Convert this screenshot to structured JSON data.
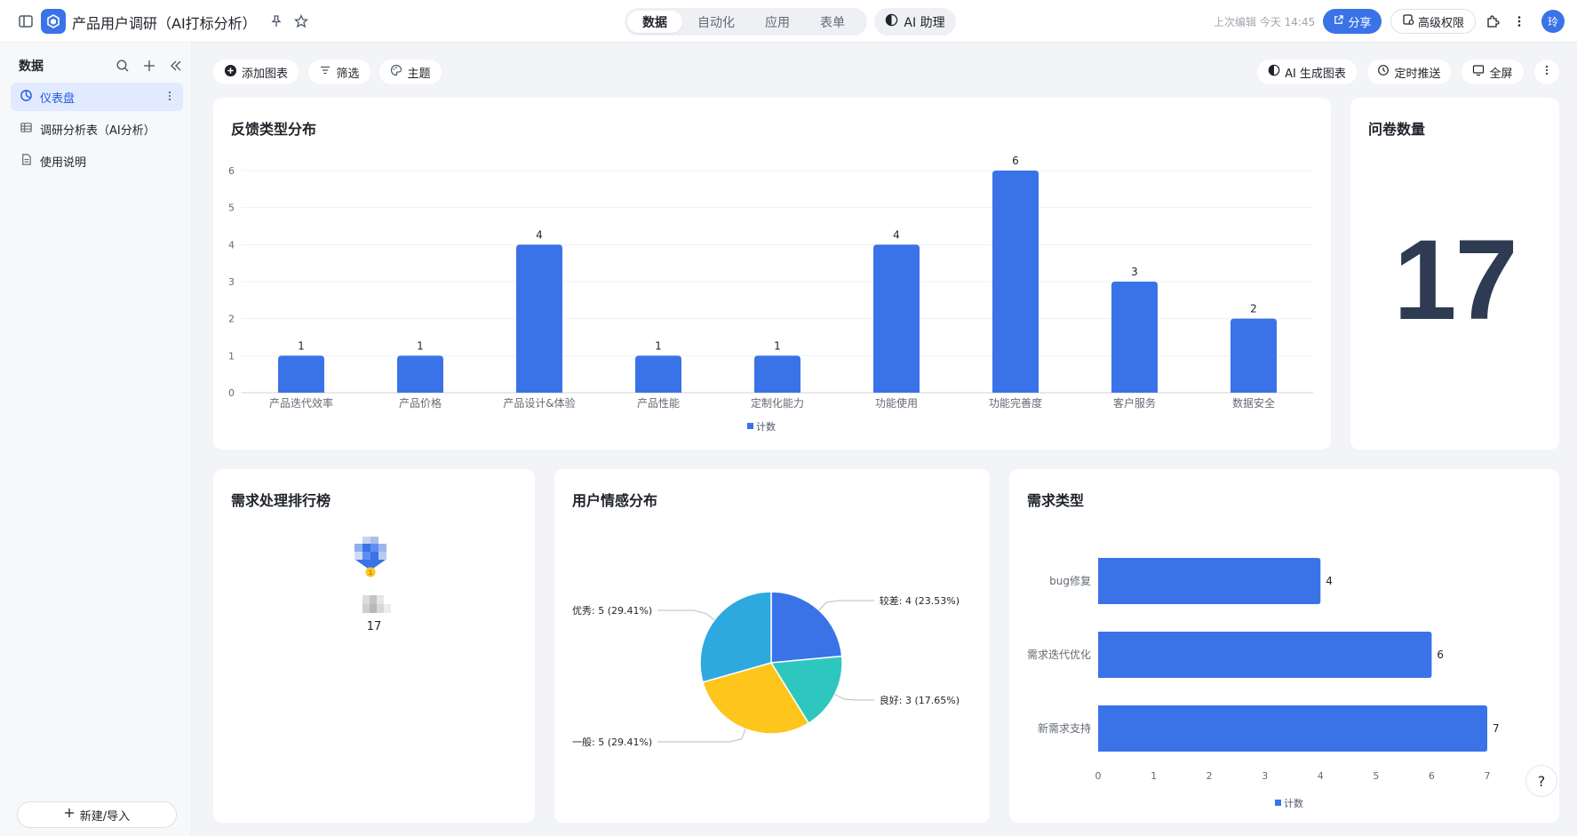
{
  "app": {
    "title": "产品用户调研（AI打标分析）",
    "mode_tabs": [
      "数据",
      "自动化",
      "应用",
      "表单"
    ],
    "ai_assistant": "AI 助理",
    "last_edit": "上次编辑 今天 14:45",
    "share": "分享",
    "permission": "高级权限",
    "avatar": "玲",
    "accent": "#3a73e8"
  },
  "sidebar": {
    "header": "数据",
    "items": [
      {
        "label": "仪表盘",
        "icon": "dashboard-icon"
      },
      {
        "label": "调研分析表（AI分析）",
        "icon": "table-icon"
      },
      {
        "label": "使用说明",
        "icon": "doc-icon"
      }
    ],
    "new_button": "新建/导入"
  },
  "toolbar": {
    "add_chart": "添加图表",
    "filter": "筛选",
    "theme": "主题",
    "ai_chart": "AI 生成图表",
    "schedule": "定时推送",
    "fullscreen": "全屏"
  },
  "cards": {
    "feedback_title": "反馈类型分布",
    "count_title": "问卷数量",
    "count_value": "17",
    "ranking_title": "需求处理排行榜",
    "ranking_value": "17",
    "sentiment_title": "用户情感分布",
    "demand_title": "需求类型"
  },
  "chart_data": [
    {
      "type": "bar",
      "title": "反馈类型分布",
      "categories": [
        "产品迭代效率",
        "产品价格",
        "产品设计&体验",
        "产品性能",
        "定制化能力",
        "功能使用",
        "功能完善度",
        "客户服务",
        "数据安全"
      ],
      "series": [
        {
          "name": "计数",
          "values": [
            1,
            1,
            4,
            1,
            1,
            4,
            6,
            3,
            2
          ]
        }
      ],
      "ylim": [
        0,
        6
      ],
      "yticks": [
        0,
        1,
        2,
        3,
        4,
        5,
        6
      ],
      "legend": "bottom",
      "grid": true,
      "color": "#3a73e8"
    },
    {
      "type": "pie",
      "title": "用户情感分布",
      "slices": [
        {
          "label": "较差",
          "value": 4,
          "text": "较差: 4 (23.53%)",
          "color": "#3a73e8"
        },
        {
          "label": "良好",
          "value": 3,
          "text": "良好: 3 (17.65%)",
          "color": "#2ec7c0"
        },
        {
          "label": "一般",
          "value": 5,
          "text": "一般: 5 (29.41%)",
          "color": "#fec51c"
        },
        {
          "label": "优秀",
          "value": 5,
          "text": "优秀: 5 (29.41%)",
          "color": "#2ea9e0"
        }
      ]
    },
    {
      "type": "bar",
      "orientation": "horizontal",
      "title": "需求类型",
      "categories": [
        "bug修复",
        "需求迭代优化",
        "新需求支持"
      ],
      "series": [
        {
          "name": "计数",
          "values": [
            4,
            6,
            7
          ]
        }
      ],
      "xlim": [
        0,
        7
      ],
      "xticks": [
        0,
        1,
        2,
        3,
        4,
        5,
        6,
        7
      ],
      "legend": "bottom",
      "color": "#3a73e8"
    }
  ]
}
